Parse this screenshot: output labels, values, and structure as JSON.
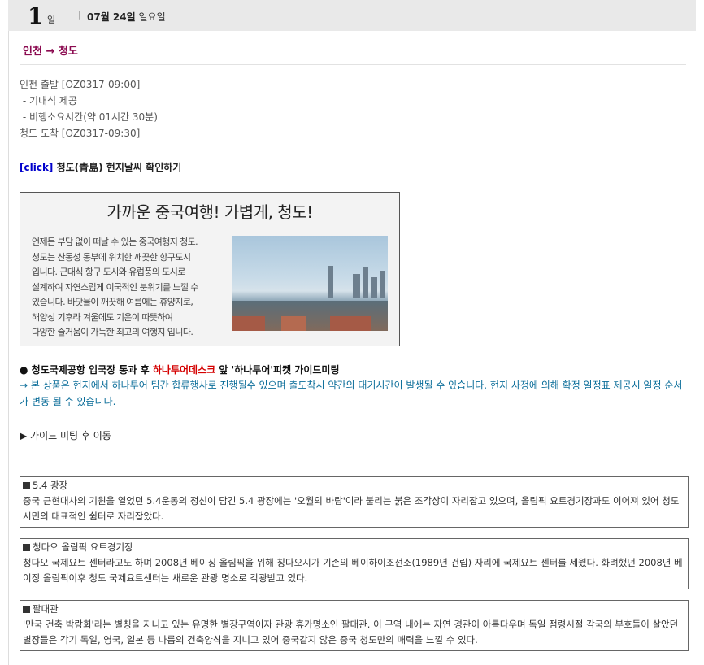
{
  "day": {
    "number": "1",
    "unit": "일",
    "separator": "|",
    "date_bold": "07월 24일",
    "weekday": "일요일"
  },
  "route": "인천 → 청도",
  "flight_lines": [
    "인천 출발 [OZ0317-09:00]",
    " - 기내식 제공",
    " - 비행소요시간(약 01시간 30분)",
    "청도 도착 [OZ0317-09:30]"
  ],
  "weather": {
    "link_label": "[click]",
    "text": " 청도(青島) 현지날씨 확인하기"
  },
  "banner": {
    "title": "가까운 중국여행! 가볍게, 청도!",
    "lines": [
      "언제든 부담 없이 떠날 수 있는 중국여행지 청도.",
      "청도는 산동성 동부에 위치한 깨끗한 항구도시",
      "입니다. 근대식 항구 도시와 유럽풍의 도시로",
      "설계하여 자연스럽게 이국적인 분위기를 느낄 수",
      "있습니다. 바닷물이 깨끗해 여름에는 휴양지로,",
      "해양성 기후라 겨울에도 기온이 따뜻하여",
      "다양한 즐거움이 가득한 최고의 여행지 입니다."
    ]
  },
  "meeting": {
    "bullet": "●",
    "part1": " 청도국제공항 입국장 통과 후 ",
    "desk": "하나투어데스크",
    "part2": " 앞 '하나투어'피켓 가이드미팅"
  },
  "notice": "→ 본 상품은 현지에서 하나투어 팀간 합류행사로 진행될수 있으며 출도착시 약간의 대기시간이 발생될 수 있습니다. 현지 사정에 의해 확정 일정표 제공시 일정 순서가 변동 될 수 있습니다.",
  "guide_move": "▶ 가이드 미팅 후 이동",
  "spots": [
    {
      "title": "5.4 광장",
      "text": "중국 근현대사의 기원을 열었던 5.4운동의 정신이 담긴 5.4 광장에는 '오월의 바람'이라 불리는 붉은 조각상이 자리잡고 있으며, 올림픽 요트경기장과도 이어져 있어 청도 시민의 대표적인 쉼터로 자리잡았다."
    },
    {
      "title": "청다오 올림픽 요트경기장",
      "text": "청다오 국제요트 센터라고도 하며 2008년 베이징 올림픽을 위해 칭다오시가 기존의 베이하이조선소(1989년 건립) 자리에 국제요트 센터를 세웠다. 화려했던 2008년 베이징 올림픽이후 청도 국제요트센터는 새로운 관광 명소로 각광받고 있다."
    },
    {
      "title": "팔대관",
      "text": "'만국 건축 박람회'라는 별칭을 지니고 있는 유명한 별장구역이자 관광 휴가명소인 팔대관. 이 구역 내에는 자연 경관이 아름다우며 독일 점령시절 각국의 부호들이 살았던 별장들은 각기 독일, 영국, 일본 등 나름의 건축양식을 지니고 있어 중국같지 않은 중국 청도만의 매력을 느낄 수 있다."
    }
  ]
}
